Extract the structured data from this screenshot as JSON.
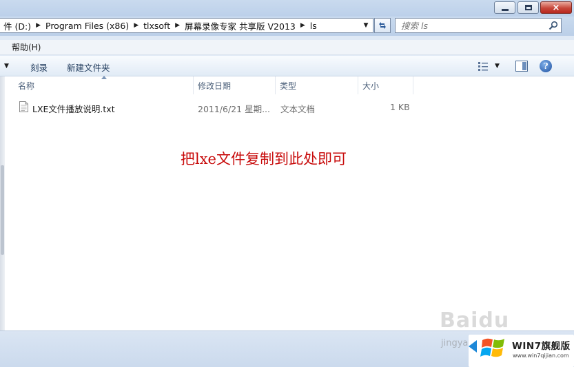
{
  "window": {
    "caption_buttons": {
      "minimize": "minimize",
      "maximize": "maximize",
      "close": "×"
    }
  },
  "address_bar": {
    "breadcrumbs": [
      "件 (D:)",
      "Program Files (x86)",
      "tlxsoft",
      "屏幕录像专家 共享版 V2013",
      "ls"
    ],
    "dropdown_glyph": "▼",
    "separator_glyph": "▶"
  },
  "search": {
    "placeholder": "搜索 ls",
    "icon": "magnifier-icon"
  },
  "menu": {
    "items": [
      "帮助(H)"
    ]
  },
  "toolbar": {
    "left_arrow": "▼",
    "burn_label": "刻录",
    "new_folder_label": "新建文件夹",
    "view_dropdown": "▼",
    "help_label": "?"
  },
  "columns": {
    "name": "名称",
    "date": "修改日期",
    "type": "类型",
    "size": "大小"
  },
  "files": [
    {
      "name": "LXE文件播放说明.txt",
      "date": "2011/6/21 星期...",
      "type": "文本文档",
      "size": "1 KB"
    }
  ],
  "annotation": {
    "text": "把lxe文件复制到此处即可",
    "color": "#c80c0c"
  },
  "watermark": {
    "baidu": "Baidu",
    "jingyan": "jingyan",
    "win7_title": "WIN7旗舰版",
    "win7_url": "www.win7qijian.com"
  },
  "colors": {
    "chrome": "#bcd0ea",
    "annotation": "#c80c0c",
    "close_button": "#c8473a"
  }
}
